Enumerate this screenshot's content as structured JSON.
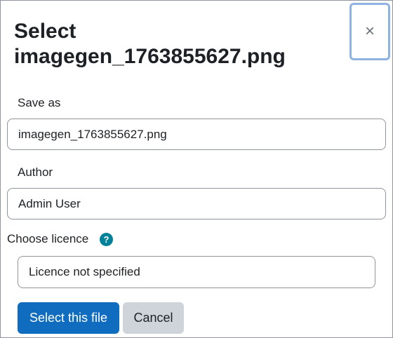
{
  "dialog": {
    "title": "Select imagegen_1763855627.png",
    "close_label": "×"
  },
  "form": {
    "save_as": {
      "label": "Save as",
      "value": "imagegen_1763855627.png"
    },
    "author": {
      "label": "Author",
      "value": "Admin User"
    },
    "licence": {
      "label": "Choose licence",
      "help_glyph": "?",
      "selected": "Licence not specified"
    }
  },
  "buttons": {
    "select_label": "Select this file",
    "cancel_label": "Cancel"
  },
  "colors": {
    "primary": "#0f6cbf",
    "secondary": "#ced4da",
    "help_icon": "#00819a",
    "focus_ring": "#8fb3e0"
  },
  "icons": {
    "close": "close-icon",
    "help": "question-circle-icon"
  }
}
